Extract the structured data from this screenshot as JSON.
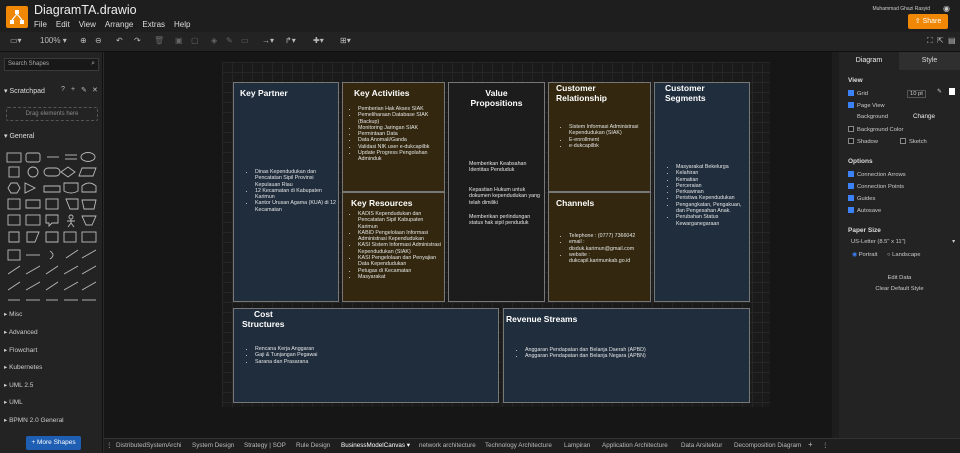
{
  "app": {
    "title": "DiagramTA.drawio",
    "user": "Muhammad Ghazi Rasyid",
    "share_label": "Share"
  },
  "menu": [
    "File",
    "Edit",
    "View",
    "Arrange",
    "Extras",
    "Help"
  ],
  "toolbar": {
    "zoom": "100%"
  },
  "left": {
    "search_placeholder": "Search Shapes",
    "scratchpad": "Scratchpad",
    "drag_hint": "Drag elements here",
    "general": "General",
    "categories": [
      "Misc",
      "Advanced",
      "Flowchart",
      "Kubernetes",
      "UML 2.5",
      "UML",
      "BPMN 2.0 General"
    ],
    "more_shapes": "More Shapes"
  },
  "canvas": {
    "key_partner": {
      "title": "Key Partner",
      "items": [
        "Dinas Kependudukan dan Pencatatan Sipil Provinsi Kepulauan Riau",
        "12 Kecamatan di Kabupaten Karimun",
        "Kantor Urusan Agama (KUA) di 12 Kecamatan"
      ]
    },
    "key_activities": {
      "title": "Key Activities",
      "items": [
        "Pemberian Hak Akses SIAK",
        "Pemeliharaan Database SIAK (Backup)",
        "Monitoring Jaringan SIAK",
        "Permintaan Data",
        "Data Anomali/Ganda",
        "Validasi NIK user e-dukcapilbk",
        "Update Progress Pengolahan Adminduk"
      ]
    },
    "key_resources": {
      "title": "Key Resources",
      "items": [
        "KADIS Kependudukan dan Pencatatan Sipil Kabupaten Karimun",
        "KABID Pengelolaan Informasi Administrasi Kependudukan",
        "KASI Sistem Informasi Administrasi Kependudukan (SIAK)",
        "KASI Pengelolaan dan Penyajian Data Kependudukan",
        "Petugas di Kecamatan",
        "Masyarakat"
      ]
    },
    "value_propositions": {
      "title1": "Value",
      "title2": "Propositions",
      "paras": [
        "Memberikan Keabsahan Identitas Penduduk",
        "Kepastian Hukum untuk dokumen kependudukan yang telah dimiliki",
        "Memberikan perlindungan status hak sipil penduduk"
      ]
    },
    "customer_relationship": {
      "title1": "Customer",
      "title2": "Relationship",
      "items": [
        "Sistem Informasi Administrasi Kependudukan (SIAK)",
        "E-enrollment",
        "e-dukcapilbk"
      ]
    },
    "channels": {
      "title": "Channels",
      "items": [
        "Telephone : (0777) 7366042",
        "email : disduk.karimun@gmail.com",
        "website : dukcapil.karimunkab.go.id"
      ]
    },
    "customer_segments": {
      "title1": "Customer",
      "title2": "Segments",
      "items": [
        "Masyarakat Bekelurga",
        "Kelahiran",
        "Kematian",
        "Perceraian",
        "Perkawinan",
        "Peristiwa Kependudukan",
        "Pengangkatan, Pengakuan, dan Pengesahan Anak.",
        "Perubahan Status Kewarganegaraan"
      ]
    },
    "cost_structures": {
      "title1": "Cost",
      "title2": "Structures",
      "items": [
        "Rencana Kerja Anggaran",
        "Gaji & Tunjangan Pegawai",
        "Sarana dan Prasarana"
      ]
    },
    "revenue_streams": {
      "title": "Revenue Streams",
      "items": [
        "Anggaran Pendapatan dan Belanja Daerah (APBD)",
        "Anggaran Pendapatan dan Belanja Negara (APBN)"
      ]
    }
  },
  "right": {
    "tab_diagram": "Diagram",
    "tab_style": "Style",
    "view": "View",
    "grid": "Grid",
    "grid_size": "10 pt",
    "page_view": "Page View",
    "background": "Background",
    "change": "Change",
    "background_color": "Background Color",
    "shadow": "Shadow",
    "sketch": "Sketch",
    "options": "Options",
    "connection_arrows": "Connection Arrows",
    "connection_points": "Connection Points",
    "guides": "Guides",
    "autosave": "Autosave",
    "paper_size": "Paper Size",
    "paper_value": "US-Letter (8.5\" x 11\")",
    "portrait": "Portrait",
    "landscape": "Landscape",
    "edit_data": "Edit Data",
    "clear_default_style": "Clear Default Style"
  },
  "tabs": [
    "DistributedSystemArchi",
    "System Design",
    "Strategy | SOP",
    "Rule Design",
    "BusinessModelCanvas",
    "network architecture",
    "Technology Architecture",
    "Lampiran",
    "Application Architecture",
    "Data Arsitektur",
    "Decomposition Diagram"
  ],
  "colors": {
    "accent": "#f08705",
    "primary": "#1e5eb3",
    "check": "#3b82f6"
  }
}
